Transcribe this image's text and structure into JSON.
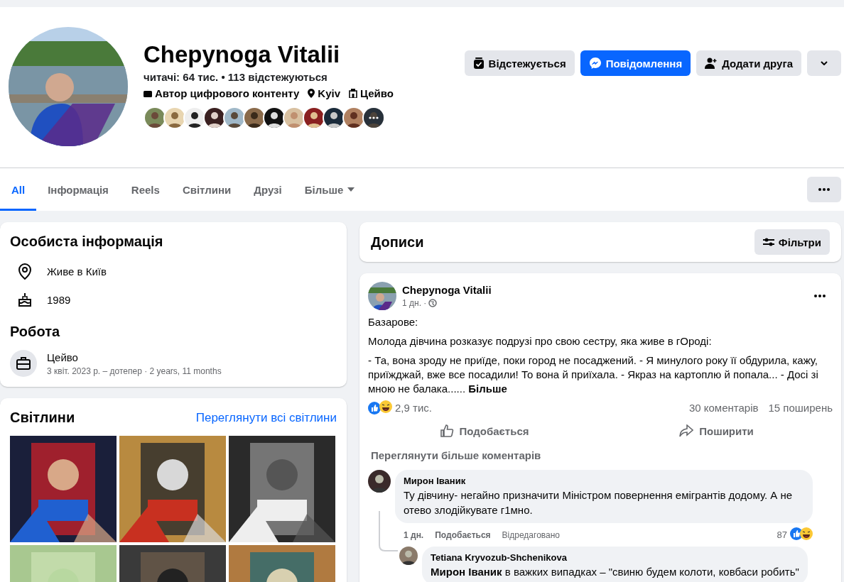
{
  "profile": {
    "name": "Chepynoga Vitalii",
    "stats": "читачі: 64 тис. • 113 відстежуються",
    "details": [
      {
        "kind": "category",
        "text": "Автор цифрового контенту"
      },
      {
        "kind": "location",
        "text": "Kyiv"
      },
      {
        "kind": "work",
        "text": "Цейво"
      }
    ],
    "friend_avatars": [
      {
        "kind": "picture"
      },
      {
        "kind": "picture"
      },
      {
        "kind": "picture"
      },
      {
        "kind": "picture"
      },
      {
        "kind": "picture"
      },
      {
        "kind": "picture"
      },
      {
        "kind": "picture"
      },
      {
        "kind": "picture"
      },
      {
        "kind": "picture"
      },
      {
        "kind": "picture"
      },
      {
        "kind": "picture"
      },
      {
        "kind": "more"
      }
    ]
  },
  "actions": [
    {
      "kind": "follow",
      "label": "Відстежується"
    },
    {
      "kind": "message",
      "label": "Повідомлення"
    },
    {
      "kind": "add-friend",
      "label": "Додати друга"
    },
    {
      "kind": "dropdown"
    }
  ],
  "tabs": [
    {
      "label": "All",
      "selected": true
    },
    {
      "label": "Інформація",
      "selected": false
    },
    {
      "label": "Reels",
      "selected": false
    },
    {
      "label": "Світлини",
      "selected": false
    },
    {
      "label": "Друзі",
      "selected": false
    },
    {
      "label": "Більше",
      "selected": false,
      "dropdown": true
    }
  ],
  "intro": {
    "title": "Особиста інформація",
    "items": [
      {
        "kind": "location",
        "text": "Живе в Київ"
      },
      {
        "kind": "birthday",
        "text": "1989"
      }
    ],
    "work_title": "Робота",
    "work": {
      "name": "Цейво",
      "period": "3 квіт. 2023 р. – дотепер · 2 years, 11 months"
    }
  },
  "photos": {
    "title": "Світлини",
    "link": "Переглянути всі світлини",
    "items": [
      {
        "kind": "picture"
      },
      {
        "kind": "picture"
      },
      {
        "kind": "picture"
      },
      {
        "kind": "picture"
      },
      {
        "kind": "picture"
      },
      {
        "kind": "picture"
      }
    ]
  },
  "posts_header": {
    "title": "Дописи",
    "filter": "Фільтри"
  },
  "post": {
    "author": "Chepynoga Vitalii",
    "time": "1 дн. ·",
    "paragraphs": [
      "Базарове:",
      "Молода дівчина розказує подрузі про свою сестру, яка живе в гОроді:",
      "- Та, вона зроду не приїде, поки город не посаджений. - Я минулого року її обдурила, кажу, приїжджай, вже все посадили! То вона й приїхала. - Якраз на картоплю й попала... - Досі зі мною не балака......"
    ],
    "more": "Більше",
    "reactions": "2,9 тис.",
    "comments_count": "30 коментарів",
    "shares": "15 поширень",
    "buttons": [
      {
        "kind": "like",
        "label": "Подобається"
      },
      {
        "kind": "share",
        "label": "Поширити"
      }
    ],
    "view_more": "Переглянути більше коментарів",
    "comments": [
      {
        "author": "Мирон Іваник",
        "text": "Ту дівчину- негайно призначити Міністром повернення емігрантів додому. А не отево злодійкувате г1мно.",
        "time": "1 дн.",
        "like": "Подобається",
        "edited": "Відредаговано",
        "reactions": "87",
        "replies": [
          {
            "author": "Tetiana Kryvozub-Shchenikova",
            "text": "**Мирон Іваник** в важких випадках – \"свиню будем колоти, ковбаси робить\""
          }
        ]
      }
    ]
  }
}
